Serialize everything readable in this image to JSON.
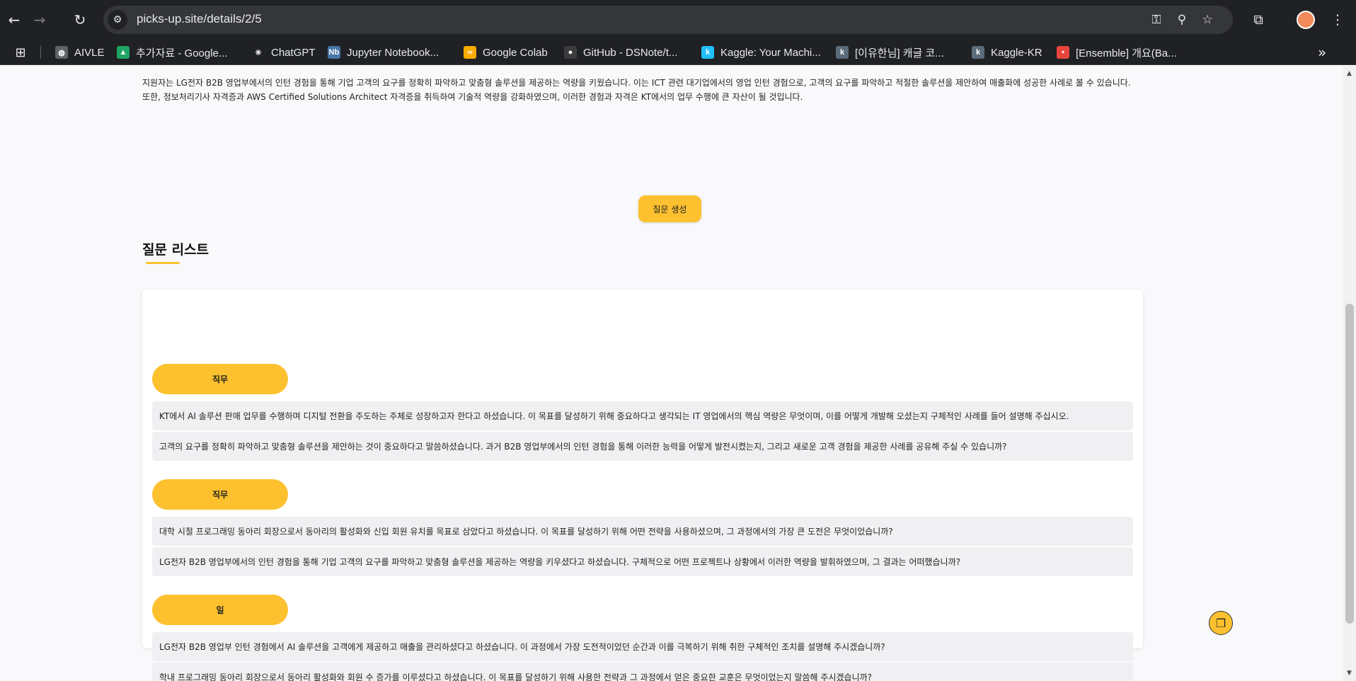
{
  "browser": {
    "url": "picks-up.site/details/2/5",
    "icons": {
      "back": "←",
      "forward": "→",
      "reload": "↻",
      "site_info": "⚙",
      "key": "⚿",
      "zoom": "⚲",
      "star": "☆",
      "extensions": "⧉",
      "menu": "⋮",
      "apps": "⊞",
      "more": "»"
    },
    "bookmarks": [
      {
        "label": "AIVLE",
        "fav": "◍",
        "color": "#5f6368"
      },
      {
        "label": "추가자료 - Google...",
        "fav": "▲",
        "color": "#1fa463"
      },
      {
        "label": "ChatGPT",
        "fav": "✳",
        "color": "#202124"
      },
      {
        "label": "Jupyter Notebook...",
        "fav": "Nb",
        "color": "#4a76a8"
      },
      {
        "label": "Google Colab",
        "fav": "∞",
        "color": "#f9ab00"
      },
      {
        "label": "GitHub - DSNote/t...",
        "fav": "●",
        "color": "#3c3c3c"
      },
      {
        "label": "Kaggle: Your Machi...",
        "fav": "k",
        "color": "#20beff"
      },
      {
        "label": "[이유한님] 캐글 코...",
        "fav": "k",
        "color": "#5b6b7a"
      },
      {
        "label": "Kaggle-KR",
        "fav": "k",
        "color": "#5b6b7a"
      },
      {
        "label": "[Ensemble] 개요(Ba...",
        "fav": "•",
        "color": "#e8453c"
      }
    ]
  },
  "page": {
    "summary": "지원자는 LG전자 B2B 영업부에서의 인턴 경험을 통해 기업 고객의 요구를 정확히 파악하고 맞춤형 솔루션을 제공하는 역량을 키웠습니다. 이는 ICT 관련 대기업에서의 영업 인턴 경험으로, 고객의 요구를 파악하고 적절한 솔루션을 제안하여 매출화에 성공한 사례로 볼 수 있습니다. 또한, 정보처리기사 자격증과 AWS Certified Solutions Architect 자격증을 취득하여 기술적 역량을 강화하였으며, 이러한 경험과 자격은 KT에서의 업무 수행에 큰 자산이 될 것입니다.",
    "generate_button": "질문 생성",
    "list_title": "질문 리스트",
    "groups": [
      {
        "category": "직무",
        "questions": [
          "KT에서 AI 솔루션 판매 업무를 수행하며 디지털 전환을 주도하는 주체로 성장하고자 한다고 하셨습니다. 이 목표를 달성하기 위해 중요하다고 생각되는 IT 영업에서의 핵심 역량은 무엇이며, 이를 어떻게 개발해 오셨는지 구체적인 사례를 들어 설명해 주십시오.",
          "고객의 요구를 정확히 파악하고 맞춤형 솔루션을 제안하는 것이 중요하다고 말씀하셨습니다. 과거 B2B 영업부에서의 인턴 경험을 통해 이러한 능력을 어떻게 발전시켰는지, 그리고 새로운 고객 경험을 제공한 사례를 공유해 주실 수 있습니까?"
        ]
      },
      {
        "category": "직무",
        "questions": [
          "대학 시절 프로그래밍 동아리 회장으로서 동아리의 활성화와 신입 회원 유치를 목표로 삼았다고 하셨습니다. 이 목표를 달성하기 위해 어떤 전략을 사용하셨으며, 그 과정에서의 가장 큰 도전은 무엇이었습니까?",
          "LG전자 B2B 영업부에서의 인턴 경험을 통해 기업 고객의 요구를 파악하고 맞춤형 솔루션을 제공하는 역량을 키우셨다고 하셨습니다. 구체적으로 어떤 프로젝트나 상황에서 이러한 역량을 발휘하였으며, 그 결과는 어떠했습니까?"
        ]
      },
      {
        "category": "일",
        "questions": [
          "LG전자 B2B 영업부 인턴 경험에서 AI 솔루션을 고객에게 제공하고 매출을 관리하셨다고 하셨습니다. 이 과정에서 가장 도전적이었던 순간과 이를 극복하기 위해 취한 구체적인 조치를 설명해 주시겠습니까?",
          "학내 프로그래밍 동아리 회장으로서 동아리 활성화와 회원 수 증가를 이루셨다고 하셨습니다. 이 목표를 달성하기 위해 사용한 전략과 그 과정에서 얻은 중요한 교훈은 무엇이었는지 말씀해 주시겠습니까?"
        ]
      }
    ],
    "fab_icon": "❐"
  }
}
